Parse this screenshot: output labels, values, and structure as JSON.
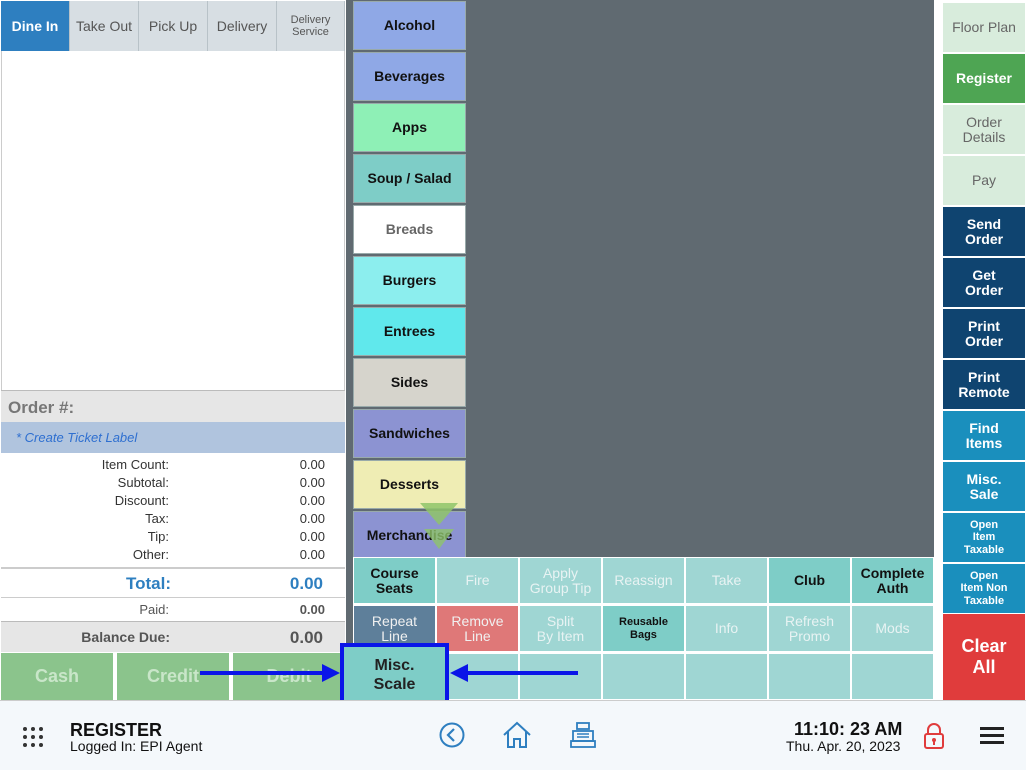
{
  "order_tabs": [
    "Dine In",
    "Take Out",
    "Pick Up",
    "Delivery",
    "Delivery\nService"
  ],
  "order": {
    "order_num_label": "Order #:",
    "ticket_label": "* Create Ticket Label",
    "summary": [
      {
        "label": "Item Count:",
        "value": "0.00"
      },
      {
        "label": "Subtotal:",
        "value": "0.00"
      },
      {
        "label": "Discount:",
        "value": "0.00"
      },
      {
        "label": "Tax:",
        "value": "0.00"
      },
      {
        "label": "Tip:",
        "value": "0.00"
      },
      {
        "label": "Other:",
        "value": "0.00"
      }
    ],
    "total_label": "Total:",
    "total_value": "0.00",
    "paid_label": "Paid:",
    "paid_value": "0.00",
    "balance_label": "Balance Due:",
    "balance_value": "0.00"
  },
  "payment_buttons": [
    "Cash",
    "Credit",
    "Debit"
  ],
  "categories": [
    {
      "label": "Alcohol",
      "color": "#8fa8e6"
    },
    {
      "label": "Beverages",
      "color": "#8fa8e6"
    },
    {
      "label": "Apps",
      "color": "#8ef0b6"
    },
    {
      "label": "Soup / Salad",
      "color": "#7ecdc7"
    },
    {
      "label": "Breads",
      "color": "#ffffff"
    },
    {
      "label": "Burgers",
      "color": "#8ceeee"
    },
    {
      "label": "Entrees",
      "color": "#60e8ec"
    },
    {
      "label": "Sides",
      "color": "#d6d4cc"
    },
    {
      "label": "Sandwiches",
      "color": "#8c93d2"
    },
    {
      "label": "Desserts",
      "color": "#efedb4"
    },
    {
      "label": "Merchandise",
      "color": "#8c93d2"
    }
  ],
  "action_rows": [
    [
      {
        "label": "Course\nSeats",
        "enabled": true,
        "color": "#7ecdc7"
      },
      {
        "label": "Fire",
        "enabled": false,
        "color": "#9fd6d3"
      },
      {
        "label": "Apply\nGroup Tip",
        "enabled": false,
        "color": "#9fd6d3"
      },
      {
        "label": "Reassign",
        "enabled": false,
        "color": "#9fd6d3"
      },
      {
        "label": "Take",
        "enabled": false,
        "color": "#9fd6d3"
      },
      {
        "label": "Club",
        "enabled": true,
        "color": "#7ecdc7"
      },
      {
        "label": "Complete\nAuth",
        "enabled": true,
        "color": "#7ecdc7"
      }
    ],
    [
      {
        "label": "Repeat\nLine",
        "enabled": true,
        "color": "#5e7f9a"
      },
      {
        "label": "Remove\nLine",
        "enabled": true,
        "color": "#df7878"
      },
      {
        "label": "Split\nBy Item",
        "enabled": false,
        "color": "#9fd6d3"
      },
      {
        "label": "Reusable\nBags",
        "enabled": true,
        "color": "#7ecdc7"
      },
      {
        "label": "Info",
        "enabled": false,
        "color": "#9fd6d3"
      },
      {
        "label": "Refresh\nPromo",
        "enabled": false,
        "color": "#9fd6d3"
      },
      {
        "label": "Mods",
        "enabled": false,
        "color": "#9fd6d3"
      }
    ]
  ],
  "misc_scale_label": "Misc.\nScale",
  "right_buttons": [
    {
      "label": "Floor Plan",
      "color": "#d8ecdc",
      "text": "#666"
    },
    {
      "label": "Register",
      "color": "#4ea553",
      "text": "#ffffff"
    },
    {
      "label": "Order\nDetails",
      "color": "#d8ecdc",
      "text": "#666"
    },
    {
      "label": "Pay",
      "color": "#d8ecdc",
      "text": "#666"
    },
    {
      "label": "Send\nOrder",
      "color": "#0f4470",
      "text": "#ffffff"
    },
    {
      "label": "Get\nOrder",
      "color": "#0f4470",
      "text": "#ffffff"
    },
    {
      "label": "Print\nOrder",
      "color": "#0f4470",
      "text": "#ffffff"
    },
    {
      "label": "Print\nRemote",
      "color": "#0f4470",
      "text": "#ffffff"
    },
    {
      "label": "Find\nItems",
      "color": "#1a8fbd",
      "text": "#ffffff"
    },
    {
      "label": "Misc.\nSale",
      "color": "#1a8fbd",
      "text": "#ffffff"
    },
    {
      "label": "Open\nItem\nTaxable",
      "color": "#1a8fbd",
      "text": "#ffffff"
    },
    {
      "label": "Open\nItem Non\nTaxable",
      "color": "#1a8fbd",
      "text": "#ffffff"
    }
  ],
  "clear_all_label": "Clear\nAll",
  "footer": {
    "app_name": "REGISTER",
    "logged_in": "Logged In:  EPI Agent",
    "time": "11:10: 23 AM",
    "date": "Thu. Apr. 20, 2023"
  },
  "icons": [
    "grid-icon",
    "back-icon",
    "home-icon",
    "cash-register-icon",
    "lock-icon",
    "menu-icon"
  ]
}
